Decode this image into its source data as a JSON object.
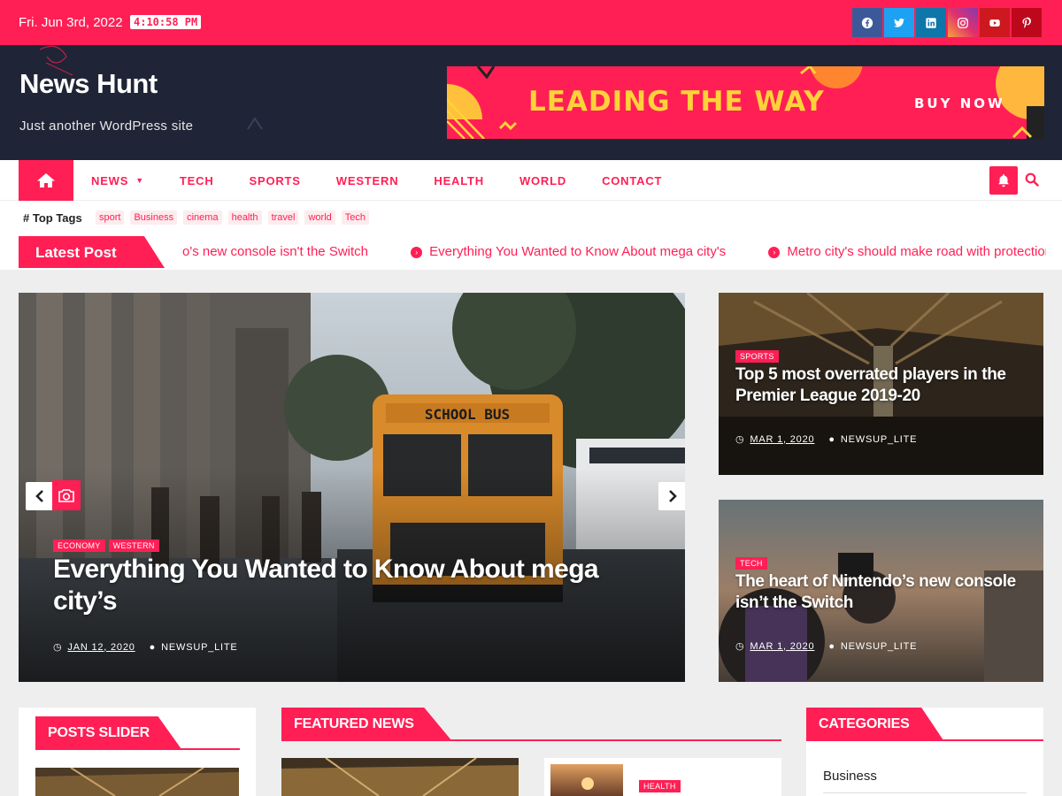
{
  "topbar": {
    "date": "Fri. Jun 3rd, 2022",
    "time": "4:10:58 PM",
    "social": [
      {
        "icon": "facebook-icon",
        "color": "#3b5998"
      },
      {
        "icon": "twitter-icon",
        "color": "#1da1f2"
      },
      {
        "icon": "linkedin-icon",
        "color": "#0e76a8"
      },
      {
        "icon": "instagram-icon",
        "color": "#c13584"
      },
      {
        "icon": "youtube-icon",
        "color": "#cc181e"
      },
      {
        "icon": "pinterest-icon",
        "color": "#bd081c"
      }
    ]
  },
  "header": {
    "site_title": "News Hunt",
    "tagline": "Just another WordPress site",
    "banner": {
      "headline": "LEADING THE WAY",
      "cta": "BUY NOW"
    }
  },
  "nav": {
    "items": [
      "NEWS",
      "TECH",
      "SPORTS",
      "WESTERN",
      "HEALTH",
      "WORLD",
      "CONTACT"
    ]
  },
  "tags": {
    "label": "Top Tags",
    "items": [
      "sport",
      "Business",
      "cinema",
      "health",
      "travel",
      "world",
      "Tech"
    ]
  },
  "latest": {
    "label": "Latest Post",
    "items": [
      "o's new console isn't the Switch",
      "Everything You Wanted to Know About mega city's",
      "Metro city's should make road with protection In mind"
    ]
  },
  "hero": {
    "categories": [
      "ECONOMY",
      "WESTERN"
    ],
    "title": "Everything You Wanted to Know About mega city’s",
    "date": "JAN 12, 2020",
    "author": "NEWSUP_LITE"
  },
  "side_posts": [
    {
      "category": "SPORTS",
      "title": "Top 5 most overrated players in the Premier League 2019-20",
      "date": "MAR 1, 2020",
      "author": "NEWSUP_LITE"
    },
    {
      "category": "TECH",
      "title": "The heart of Nintendo’s new console isn’t the Switch",
      "date": "MAR 1, 2020",
      "author": "NEWSUP_LITE"
    }
  ],
  "sections": {
    "posts_slider": "POSTS SLIDER",
    "featured": "FEATURED NEWS",
    "categories": "CATEGORIES",
    "featured_card_category": "HEALTH",
    "category_first": "Business"
  },
  "colors": {
    "accent": "#ff1f55",
    "header_bg": "#1f2536"
  }
}
